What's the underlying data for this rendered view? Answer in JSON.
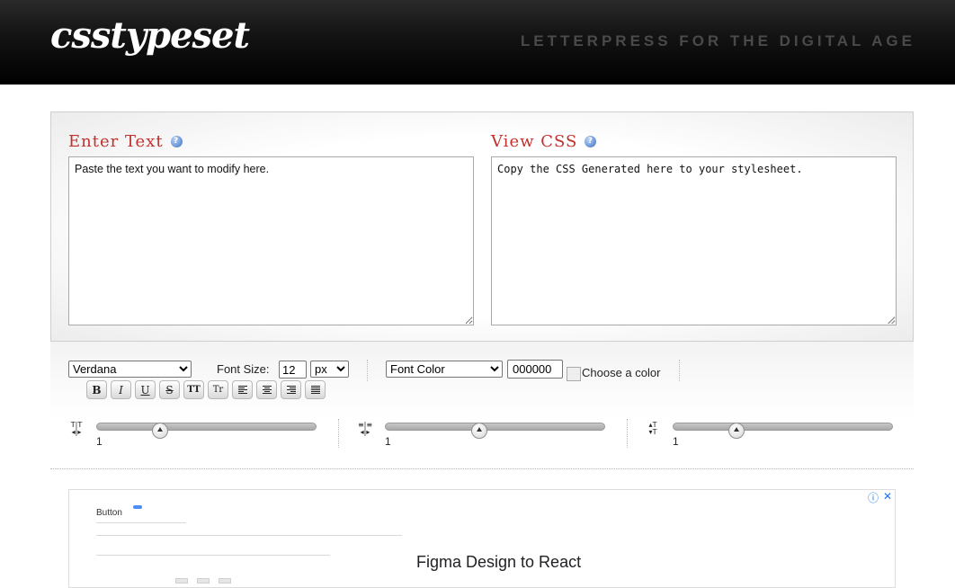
{
  "header": {
    "logo": "csstypeset",
    "tagline": "LETTERPRESS FOR THE DIGITAL AGE"
  },
  "editor": {
    "enter_title": "Enter Text",
    "enter_text": "Paste the text you want to modify here.",
    "css_title": "View CSS",
    "css_text": "Copy the CSS Generated here to your stylesheet.",
    "help_glyph": "?"
  },
  "controls": {
    "font_family": "Verdana",
    "font_size_label": "Font Size:",
    "font_size_value": "12",
    "font_size_unit": "px",
    "font_color_label": "Font Color",
    "color_value": "000000",
    "choose_color": "Choose a color",
    "format_buttons": [
      "B",
      "I",
      "U",
      "S",
      "TT",
      "Tr"
    ],
    "sliders": [
      {
        "name": "letter-spacing",
        "value": "1",
        "level": 0.27
      },
      {
        "name": "word-spacing",
        "value": "1",
        "level": 0.42
      },
      {
        "name": "line-height",
        "value": "1",
        "level": 0.27
      }
    ]
  },
  "ad": {
    "thumb_title": "Button",
    "headline": "Figma Design to React",
    "info_glyph": "ⓘ",
    "close_glyph": "✕"
  }
}
